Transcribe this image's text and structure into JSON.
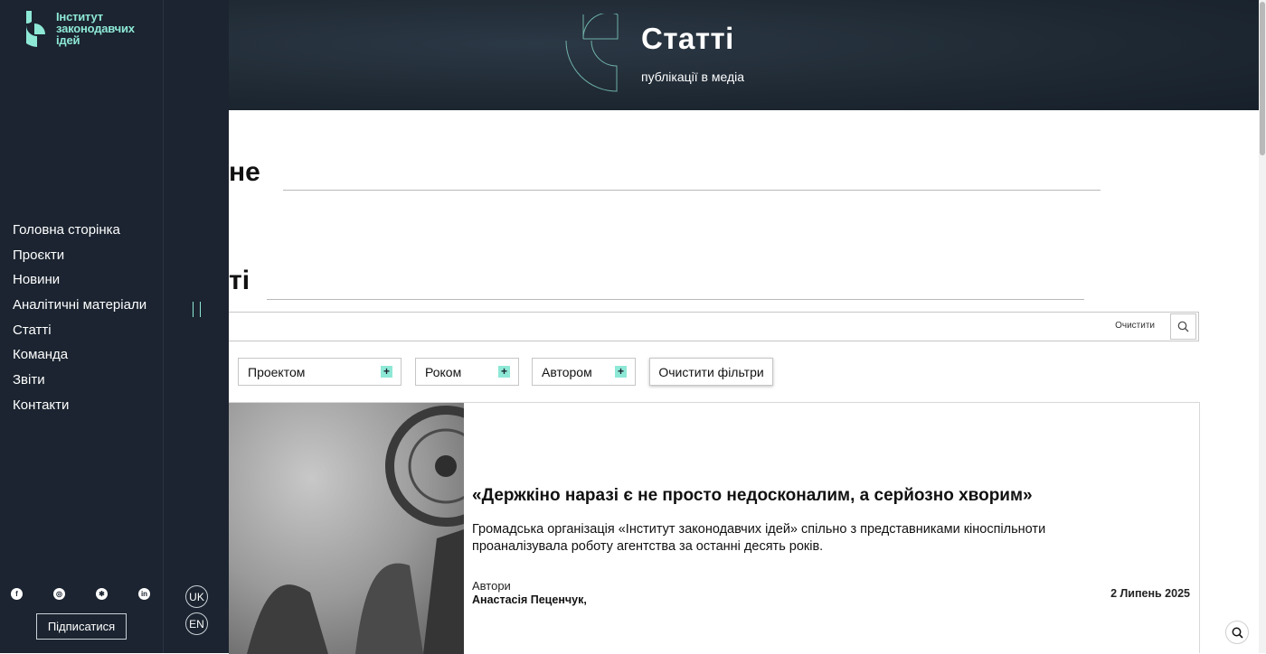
{
  "logo": {
    "line1": "Інститут",
    "line2": "законодавчих",
    "line3": "ідей"
  },
  "nav": {
    "items": [
      "Головна сторінка",
      "Проєкти",
      "Новини",
      "Аналітичні матеріали",
      "Статті",
      "Команда",
      "Звіти",
      "Контакти"
    ]
  },
  "subscribe_label": "Підписатися",
  "languages": [
    "UK",
    "EN"
  ],
  "hero": {
    "title": "Статті",
    "subtitle": "публікації в медіа"
  },
  "sections": {
    "heading1_partial": "не",
    "heading2_partial": "ті"
  },
  "search": {
    "clear_label": "Очистити"
  },
  "filters": {
    "project": "Проектом",
    "year": "Роком",
    "author": "Автором",
    "clear": "Очистити фільтри"
  },
  "article": {
    "title": "«Держкіно наразі є не просто недосконалим, а серйозно хворим»",
    "description": "Громадська організація «Інститут законодавчих ідей» спільно з представниками кіноспільноти проаналізувала роботу агентства за останні десять років.",
    "authors_label": "Автори",
    "authors": "Анастасія Пеценчук,",
    "date": "2 Липень 2025"
  },
  "colors": {
    "accent": "#8ee8d6",
    "sidebar": "#1b2430",
    "hero": "#1f2a35"
  }
}
